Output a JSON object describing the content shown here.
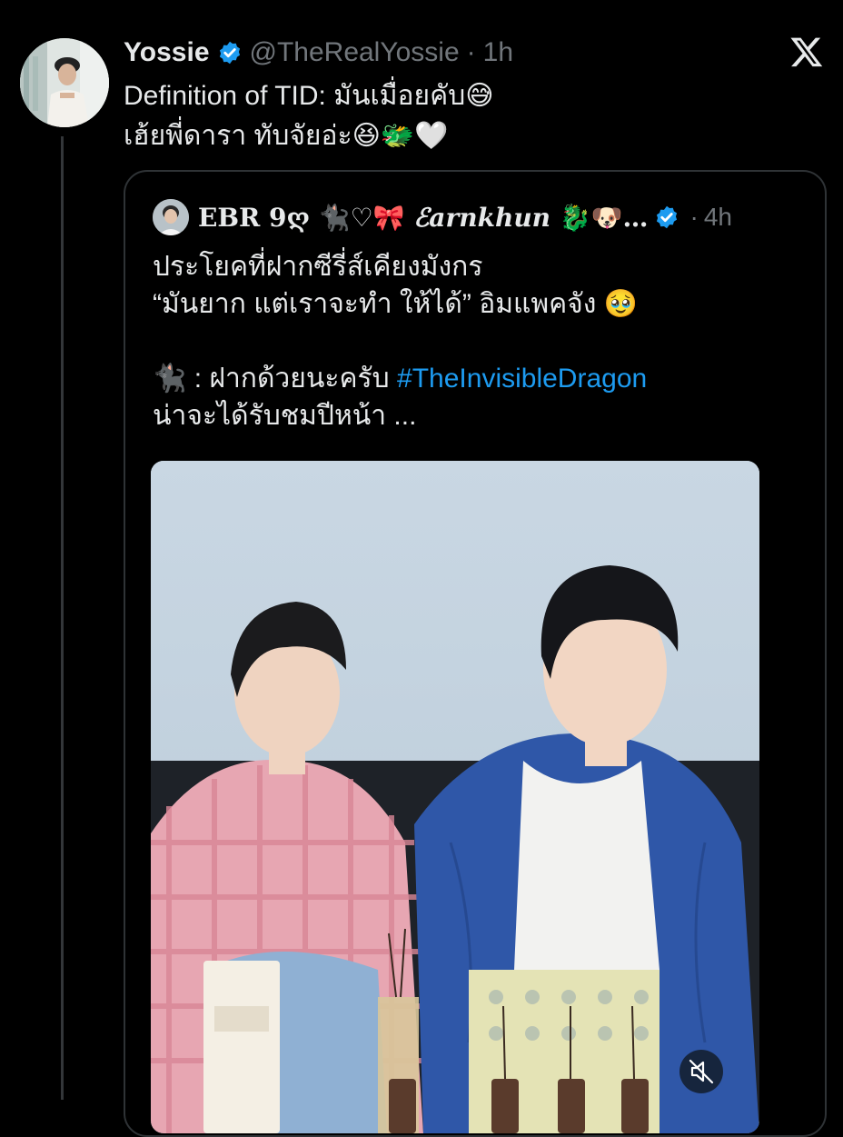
{
  "tweet": {
    "author_name": "Yossie",
    "author_handle": "@TheRealYossie",
    "separator": "·",
    "time": "1h",
    "text_line1": "Definition of TID: มันเมื่อยคับ",
    "text_line1_emoji": "😅",
    "text_line2": "เฮ้ยพี่ดารา ทับจัยอ่ะ",
    "text_line2_emoji": "😆🐲🤍",
    "verified_color": "#1d9bf0"
  },
  "quoted": {
    "author_name": "EBR 9ღ ",
    "author_name_symbols": "🐈‍⬛♡🎀",
    "author_name_fancy": " ℰarnkhun ",
    "author_name_emoji": "🐉🐶…",
    "separator": "·",
    "time": "4h",
    "line1": "ประโยคที่ฝากซีรี่ส์เคียงมังกร",
    "line2": "“มันยาก แต่เราจะทำ ให้ได้” อิมแพคจัง ",
    "line2_emoji": "🥹",
    "line3_emoji": "🐈‍⬛",
    "line3_text": " : ฝากด้วยนะครับ ",
    "hashtag": "#TheInvisibleDragon",
    "line4": "น่าจะได้รับชมปีหน้า ..."
  },
  "colors": {
    "background": "#000000",
    "text": "#e7e9ea",
    "secondary": "#71767b",
    "accent": "#1d9bf0",
    "border": "#2f3336"
  },
  "icons": {
    "platform_logo": "x-logo-icon",
    "mute": "volume-mute-icon",
    "verified": "verified-badge-icon"
  }
}
